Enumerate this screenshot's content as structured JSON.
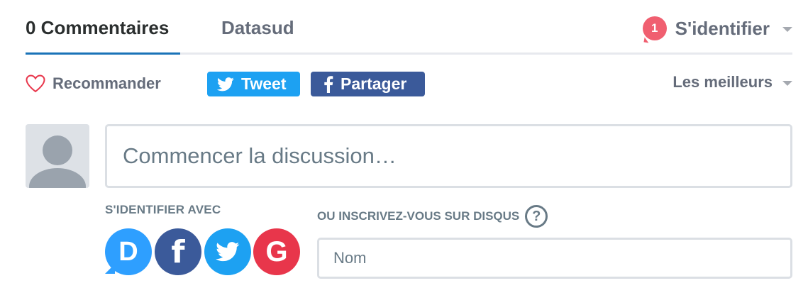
{
  "nav": {
    "comments_tab": "0 Commentaires",
    "site_tab": "Datasud",
    "notification_count": "1",
    "login_label": "S'identifier"
  },
  "actions": {
    "recommend_label": "Recommander",
    "tweet_label": "Tweet",
    "share_label": "Partager",
    "sort_label": "Les meilleurs"
  },
  "composer": {
    "placeholder": "Commencer la discussion…",
    "login_with_label": "S'IDENTIFIER AVEC",
    "signup_label": "OU INSCRIVEZ-VOUS SUR DISQUS",
    "help_symbol": "?",
    "name_placeholder": "Nom",
    "social_providers": [
      {
        "name": "Disqus",
        "letter": "D",
        "color": "#2e9fff"
      },
      {
        "name": "Facebook",
        "letter": "f",
        "color": "#3b5a9a"
      },
      {
        "name": "Twitter",
        "icon": "twitter-bird-icon",
        "color": "#1da1f2"
      },
      {
        "name": "Google",
        "letter": "G",
        "color": "#e8364b"
      }
    ]
  },
  "colors": {
    "accent_blue": "#2e9fff",
    "badge_red": "#f05f70",
    "twitter": "#1da1f2",
    "facebook": "#3b5a9a",
    "google": "#e8364b",
    "muted_text": "#656c7a"
  }
}
